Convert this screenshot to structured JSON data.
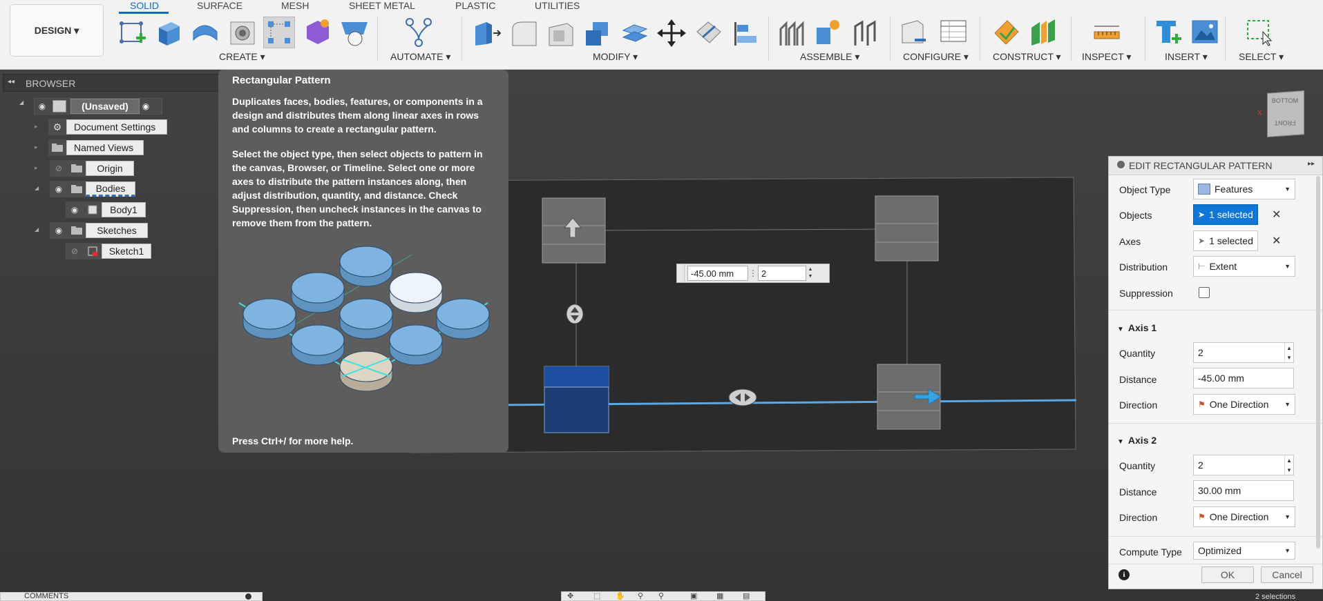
{
  "workspace": {
    "label": "DESIGN ▾"
  },
  "tabs": [
    {
      "label": "SOLID",
      "active": true
    },
    {
      "label": "SURFACE"
    },
    {
      "label": "MESH"
    },
    {
      "label": "SHEET METAL"
    },
    {
      "label": "PLASTIC"
    },
    {
      "label": "UTILITIES"
    }
  ],
  "toolbar_groups": {
    "create": "CREATE ▾",
    "automate": "AUTOMATE ▾",
    "modify": "MODIFY ▾",
    "assemble": "ASSEMBLE ▾",
    "configure": "CONFIGURE ▾",
    "construct": "CONSTRUCT ▾",
    "inspect": "INSPECT ▾",
    "insert": "INSERT ▾",
    "select": "SELECT ▾"
  },
  "browser": {
    "title": "BROWSER",
    "collapse_glyph": "◂◂",
    "items": [
      {
        "label": "(Unsaved)"
      },
      {
        "label": "Document Settings"
      },
      {
        "label": "Named Views"
      },
      {
        "label": "Origin"
      },
      {
        "label": "Bodies"
      },
      {
        "label": "Body1"
      },
      {
        "label": "Sketches"
      },
      {
        "label": "Sketch1"
      }
    ]
  },
  "tooltip": {
    "title": "Rectangular Pattern",
    "para1": "Duplicates faces, bodies, features, or components in a design and distributes them along linear axes in rows and columns to create a rectangular pattern.",
    "para2": "Select the object type, then select objects to pattern in the canvas, Browser, or Timeline. Select one or more axes to distribute the pattern instances along, then adjust distribution, quantity, and distance. Check Suppression, then uncheck instances in the canvas to remove them from the pattern.",
    "footer": "Press Ctrl+/ for more help."
  },
  "canvas_input": {
    "distance": "-45.00 mm",
    "quantity": "2"
  },
  "viewcube": {
    "top": "BOTTOM",
    "front": "FRONT",
    "x_label": "X"
  },
  "panel": {
    "title": "EDIT RECTANGULAR PATTERN",
    "expand_glyph": "▸▸",
    "object_type_label": "Object Type",
    "object_type_value": "Features",
    "objects_label": "Objects",
    "objects_value": "1 selected",
    "axes_label": "Axes",
    "axes_value": "1 selected",
    "distribution_label": "Distribution",
    "distribution_value": "Extent",
    "suppression_label": "Suppression",
    "axis1": {
      "title": "Axis 1",
      "quantity_label": "Quantity",
      "quantity_value": "2",
      "distance_label": "Distance",
      "distance_value": "-45.00 mm",
      "direction_label": "Direction",
      "direction_value": "One Direction"
    },
    "axis2": {
      "title": "Axis 2",
      "quantity_label": "Quantity",
      "quantity_value": "2",
      "distance_label": "Distance",
      "distance_value": "30.00 mm",
      "direction_label": "Direction",
      "direction_value": "One Direction"
    },
    "compute_type_label": "Compute Type",
    "compute_type_value": "Optimized",
    "ok_label": "OK",
    "cancel_label": "Cancel"
  },
  "bottom": {
    "comments_label": "COMMENTS",
    "status_text": "2 selections"
  },
  "colors": {
    "accent": "#0b6cd4",
    "selected": "#0e77d6",
    "pattern_line": "#5aa9e6"
  }
}
